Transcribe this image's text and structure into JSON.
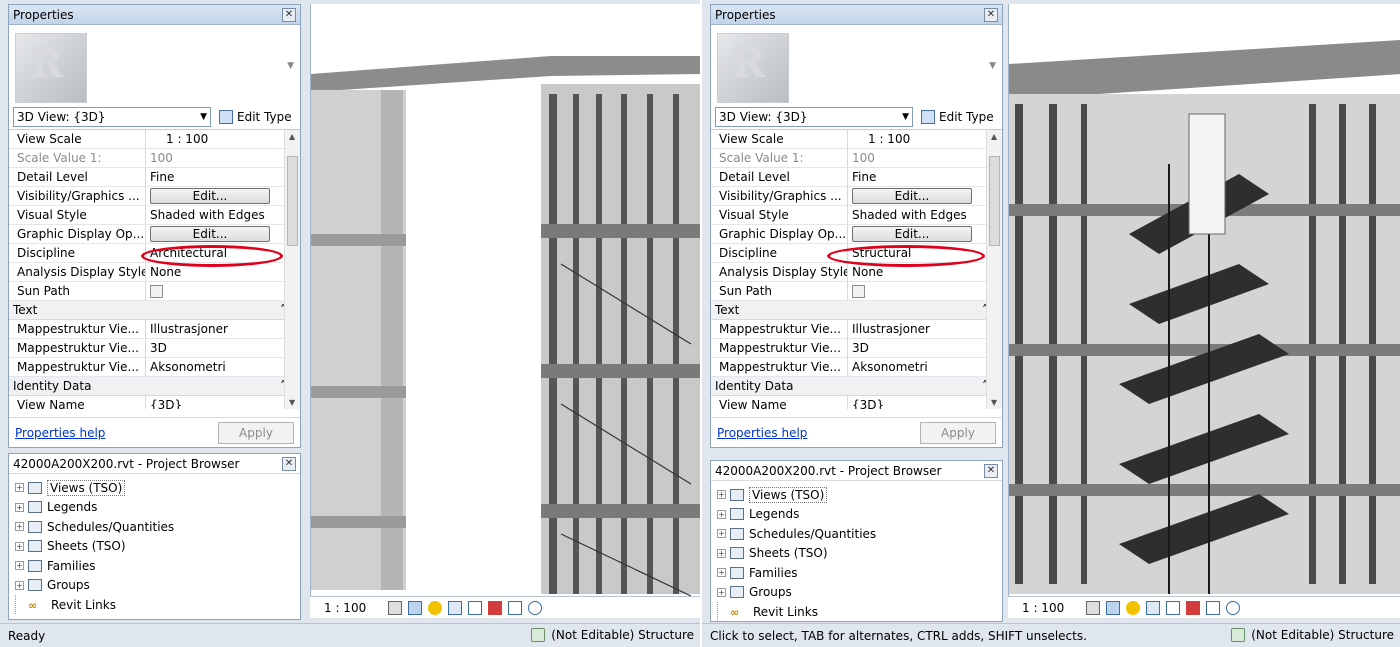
{
  "left": {
    "properties": {
      "title": "Properties",
      "type_selector": "3D View: {3D}",
      "edit_type": "Edit Type",
      "rows": [
        {
          "label": "View Scale",
          "value": "1 : 100"
        },
        {
          "label": "Scale Value    1:",
          "value": "100"
        },
        {
          "label": "Detail Level",
          "value": "Fine"
        },
        {
          "label": "Visibility/Graphics ...",
          "value": "Edit..."
        },
        {
          "label": "Visual Style",
          "value": "Shaded with Edges"
        },
        {
          "label": "Graphic Display Op...",
          "value": "Edit..."
        },
        {
          "label": "Discipline",
          "value": "Architectural"
        },
        {
          "label": "Analysis Display Style",
          "value": "None"
        },
        {
          "label": "Sun Path",
          "value": ""
        }
      ],
      "group_text": "Text",
      "text_rows": [
        {
          "label": "Mappestruktur Vie...",
          "value": "Illustrasjoner"
        },
        {
          "label": "Mappestruktur Vie...",
          "value": "3D"
        },
        {
          "label": "Mappestruktur Vie...",
          "value": "Aksonometri"
        }
      ],
      "group_identity": "Identity Data",
      "view_name_label": "View Name",
      "view_name_value": "{3D}",
      "help": "Properties help",
      "apply": "Apply"
    },
    "browser": {
      "title": "42000A200X200.rvt - Project Browser",
      "items": [
        "Views (TSO)",
        "Legends",
        "Schedules/Quantities",
        "Sheets (TSO)",
        "Families",
        "Groups",
        "Revit Links"
      ]
    },
    "scale": "1 : 100",
    "status": "Ready",
    "workset": "(Not Editable) Structure"
  },
  "right": {
    "properties": {
      "title": "Properties",
      "type_selector": "3D View: {3D}",
      "edit_type": "Edit Type",
      "rows": [
        {
          "label": "View Scale",
          "value": "1 : 100"
        },
        {
          "label": "Scale Value    1:",
          "value": "100"
        },
        {
          "label": "Detail Level",
          "value": "Fine"
        },
        {
          "label": "Visibility/Graphics ...",
          "value": "Edit..."
        },
        {
          "label": "Visual Style",
          "value": "Shaded with Edges"
        },
        {
          "label": "Graphic Display Op...",
          "value": "Edit..."
        },
        {
          "label": "Discipline",
          "value": "Structural"
        },
        {
          "label": "Analysis Display Style",
          "value": "None"
        },
        {
          "label": "Sun Path",
          "value": ""
        }
      ],
      "group_text": "Text",
      "text_rows": [
        {
          "label": "Mappestruktur Vie...",
          "value": "Illustrasjoner"
        },
        {
          "label": "Mappestruktur Vie...",
          "value": "3D"
        },
        {
          "label": "Mappestruktur Vie...",
          "value": "Aksonometri"
        }
      ],
      "group_identity": "Identity Data",
      "view_name_label": "View Name",
      "view_name_value": "{3D}",
      "help": "Properties help",
      "apply": "Apply"
    },
    "browser": {
      "title": "42000A200X200.rvt - Project Browser",
      "items": [
        "Views (TSO)",
        "Legends",
        "Schedules/Quantities",
        "Sheets (TSO)",
        "Families",
        "Groups",
        "Revit Links"
      ]
    },
    "scale": "1 : 100",
    "status": "Click to select, TAB for alternates, CTRL adds, SHIFT unselects.",
    "workset": "(Not Editable) Structure"
  },
  "icons": [
    "close-icon",
    "revit-logo-icon",
    "dropdown-arrow-icon",
    "edit-type-icon",
    "collapse-icon",
    "checkbox-icon",
    "expand-icon",
    "views-icon",
    "legends-icon",
    "schedules-icon",
    "sheets-icon",
    "families-icon",
    "groups-icon",
    "revit-links-icon",
    "workset-icon"
  ],
  "colors": {
    "highlight_oval": "#e1001a",
    "panel_title": "#c3d4ea",
    "link": "#0033cc"
  }
}
